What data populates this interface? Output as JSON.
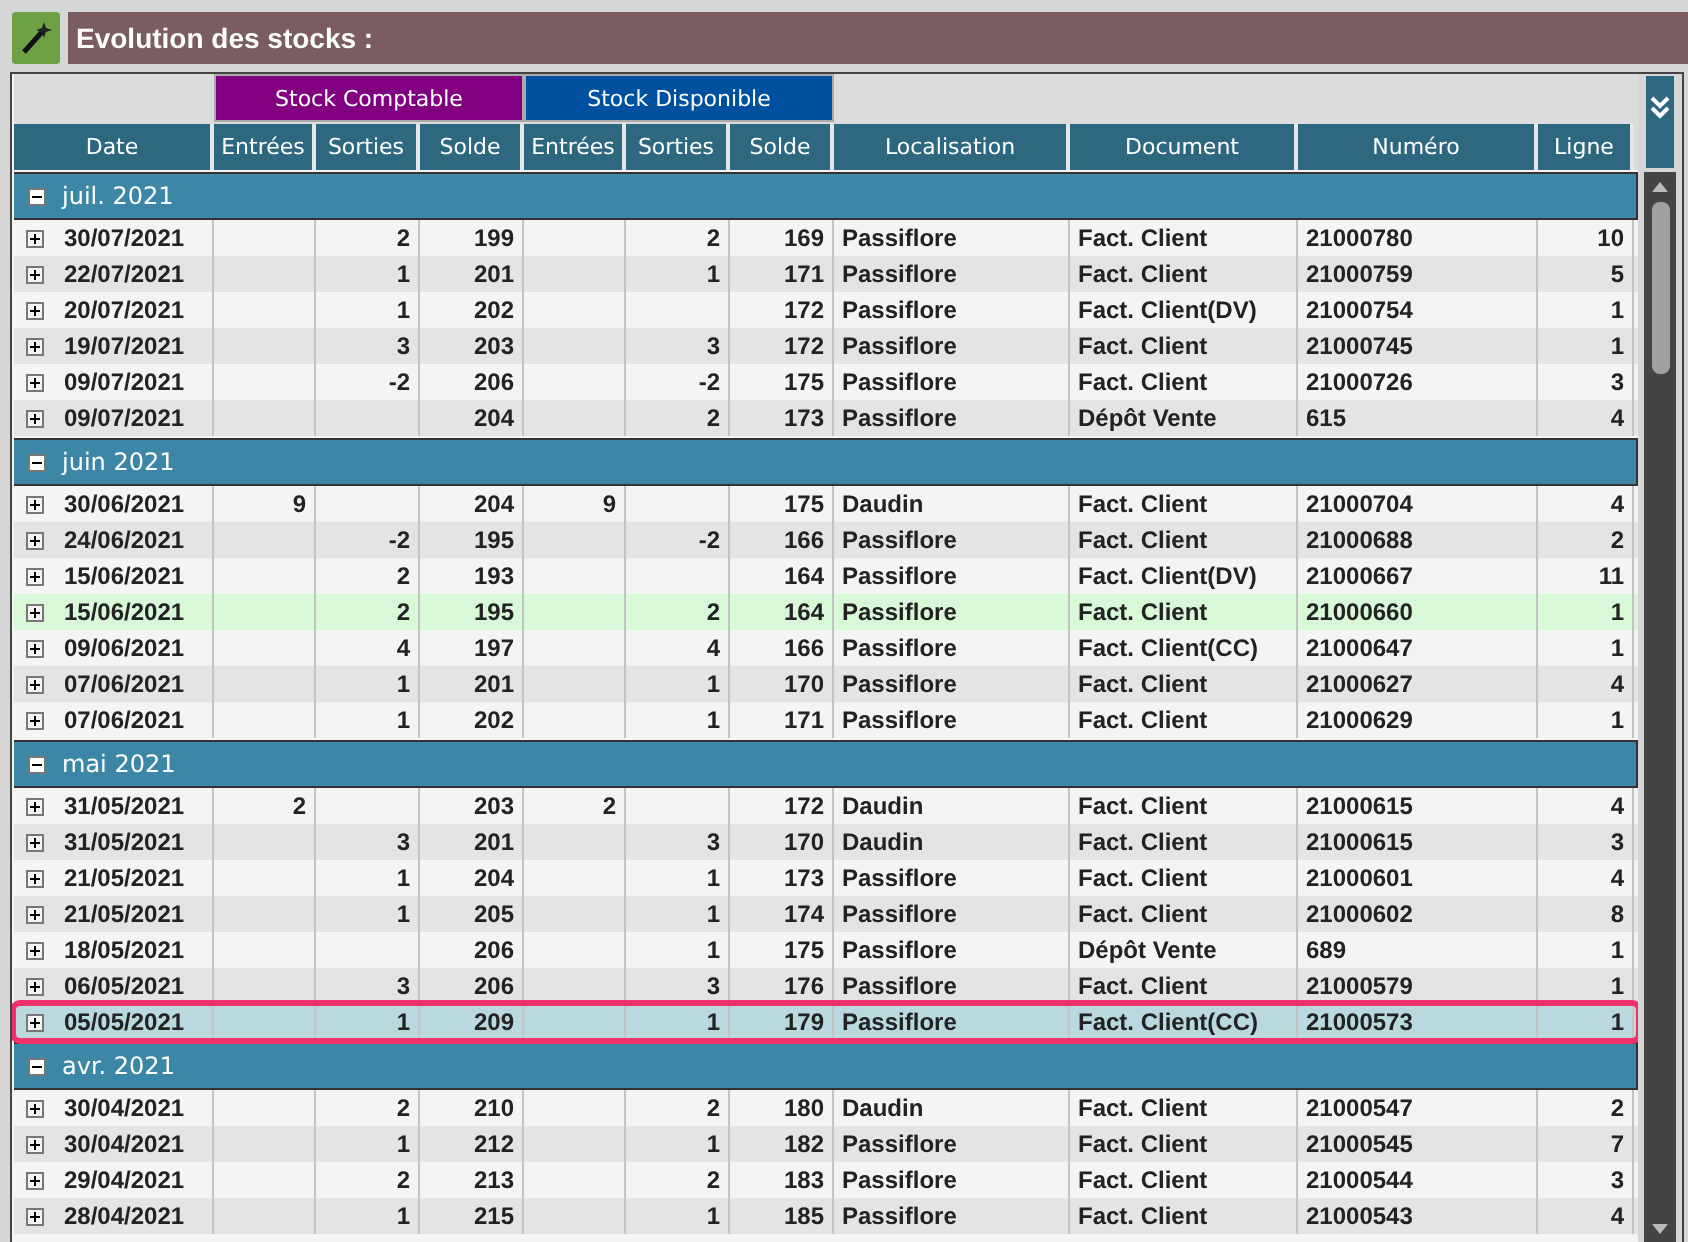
{
  "title": "Evolution des stocks :",
  "column_groups": [
    {
      "label": "Stock Comptable",
      "color": "#800080"
    },
    {
      "label": "Stock Disponible",
      "color": "#0050a0"
    }
  ],
  "columns": [
    "Date",
    "Entrées",
    "Sorties",
    "Solde",
    "Entrées",
    "Sorties",
    "Solde",
    "Localisation",
    "Document",
    "Numéro",
    "Ligne"
  ],
  "months": [
    {
      "label": "juil. 2021",
      "expanded": true,
      "rows": [
        {
          "expanded": false,
          "selected": false,
          "highlighted": false,
          "date": "30/07/2021",
          "out_accounting": "2",
          "balance_accounting": "199",
          "out_available": "2",
          "balance_available": "169",
          "location": "Passiflore",
          "document": "Fact. Client",
          "number": "21000780",
          "line": "10"
        },
        {
          "expanded": false,
          "selected": false,
          "highlighted": false,
          "date": "22/07/2021",
          "out_accounting": "1",
          "balance_accounting": "201",
          "out_available": "1",
          "balance_available": "171",
          "location": "Passiflore",
          "document": "Fact. Client",
          "number": "21000759",
          "line": "5"
        },
        {
          "expanded": false,
          "selected": false,
          "highlighted": false,
          "date": "20/07/2021",
          "out_accounting": "1",
          "balance_accounting": "202",
          "balance_available": "172",
          "location": "Passiflore",
          "document": "Fact. Client(DV)",
          "number": "21000754",
          "line": "1"
        },
        {
          "expanded": false,
          "selected": false,
          "highlighted": false,
          "date": "19/07/2021",
          "out_accounting": "3",
          "balance_accounting": "203",
          "out_available": "3",
          "balance_available": "172",
          "location": "Passiflore",
          "document": "Fact. Client",
          "number": "21000745",
          "line": "1"
        },
        {
          "expanded": false,
          "selected": false,
          "highlighted": false,
          "date": "09/07/2021",
          "out_accounting": "-2",
          "balance_accounting": "206",
          "out_available": "-2",
          "balance_available": "175",
          "location": "Passiflore",
          "document": "Fact. Client",
          "number": "21000726",
          "line": "3"
        },
        {
          "expanded": false,
          "selected": false,
          "highlighted": false,
          "date": "09/07/2021",
          "balance_accounting": "204",
          "out_available": "2",
          "balance_available": "173",
          "location": "Passiflore",
          "document": "Dépôt Vente",
          "number": "615",
          "line": "4"
        }
      ]
    },
    {
      "label": "juin 2021",
      "expanded": true,
      "rows": [
        {
          "expanded": false,
          "selected": false,
          "highlighted": false,
          "date": "30/06/2021",
          "in_accounting": "9",
          "balance_accounting": "204",
          "in_available": "9",
          "balance_available": "175",
          "location": "Daudin",
          "document": "Fact. Client",
          "number": "21000704",
          "line": "4"
        },
        {
          "expanded": false,
          "selected": false,
          "highlighted": false,
          "date": "24/06/2021",
          "out_accounting": "-2",
          "balance_accounting": "195",
          "out_available": "-2",
          "balance_available": "166",
          "location": "Passiflore",
          "document": "Fact. Client",
          "number": "21000688",
          "line": "2"
        },
        {
          "expanded": false,
          "selected": false,
          "highlighted": false,
          "date": "15/06/2021",
          "out_accounting": "2",
          "balance_accounting": "193",
          "balance_available": "164",
          "location": "Passiflore",
          "document": "Fact. Client(DV)",
          "number": "21000667",
          "line": "11"
        },
        {
          "expanded": false,
          "selected": false,
          "highlighted": true,
          "date": "15/06/2021",
          "out_accounting": "2",
          "balance_accounting": "195",
          "out_available": "2",
          "balance_available": "164",
          "location": "Passiflore",
          "document": "Fact. Client",
          "number": "21000660",
          "line": "1"
        },
        {
          "expanded": false,
          "selected": false,
          "highlighted": false,
          "date": "09/06/2021",
          "out_accounting": "4",
          "balance_accounting": "197",
          "out_available": "4",
          "balance_available": "166",
          "location": "Passiflore",
          "document": "Fact. Client(CC)",
          "number": "21000647",
          "line": "1"
        },
        {
          "expanded": false,
          "selected": false,
          "highlighted": false,
          "date": "07/06/2021",
          "out_accounting": "1",
          "balance_accounting": "201",
          "out_available": "1",
          "balance_available": "170",
          "location": "Passiflore",
          "document": "Fact. Client",
          "number": "21000627",
          "line": "4"
        },
        {
          "expanded": false,
          "selected": false,
          "highlighted": false,
          "date": "07/06/2021",
          "out_accounting": "1",
          "balance_accounting": "202",
          "out_available": "1",
          "balance_available": "171",
          "location": "Passiflore",
          "document": "Fact. Client",
          "number": "21000629",
          "line": "1"
        }
      ]
    },
    {
      "label": "mai 2021",
      "expanded": true,
      "rows": [
        {
          "expanded": false,
          "selected": false,
          "highlighted": false,
          "date": "31/05/2021",
          "in_accounting": "2",
          "balance_accounting": "203",
          "in_available": "2",
          "balance_available": "172",
          "location": "Daudin",
          "document": "Fact. Client",
          "number": "21000615",
          "line": "4"
        },
        {
          "expanded": false,
          "selected": false,
          "highlighted": false,
          "date": "31/05/2021",
          "out_accounting": "3",
          "balance_accounting": "201",
          "out_available": "3",
          "balance_available": "170",
          "location": "Daudin",
          "document": "Fact. Client",
          "number": "21000615",
          "line": "3"
        },
        {
          "expanded": false,
          "selected": false,
          "highlighted": false,
          "date": "21/05/2021",
          "out_accounting": "1",
          "balance_accounting": "204",
          "out_available": "1",
          "balance_available": "173",
          "location": "Passiflore",
          "document": "Fact. Client",
          "number": "21000601",
          "line": "4"
        },
        {
          "expanded": false,
          "selected": false,
          "highlighted": false,
          "date": "21/05/2021",
          "out_accounting": "1",
          "balance_accounting": "205",
          "out_available": "1",
          "balance_available": "174",
          "location": "Passiflore",
          "document": "Fact. Client",
          "number": "21000602",
          "line": "8"
        },
        {
          "expanded": false,
          "selected": false,
          "highlighted": false,
          "date": "18/05/2021",
          "balance_accounting": "206",
          "out_available": "1",
          "balance_available": "175",
          "location": "Passiflore",
          "document": "Dépôt Vente",
          "number": "689",
          "line": "1"
        },
        {
          "expanded": false,
          "selected": false,
          "highlighted": false,
          "date": "06/05/2021",
          "out_accounting": "3",
          "balance_accounting": "206",
          "out_available": "3",
          "balance_available": "176",
          "location": "Passiflore",
          "document": "Fact. Client",
          "number": "21000579",
          "line": "1"
        },
        {
          "expanded": false,
          "selected": true,
          "highlighted": false,
          "date": "05/05/2021",
          "out_accounting": "1",
          "balance_accounting": "209",
          "out_available": "1",
          "balance_available": "179",
          "location": "Passiflore",
          "document": "Fact. Client(CC)",
          "number": "21000573",
          "line": "1"
        }
      ]
    },
    {
      "label": "avr. 2021",
      "expanded": true,
      "rows": [
        {
          "expanded": false,
          "selected": false,
          "highlighted": false,
          "date": "30/04/2021",
          "out_accounting": "2",
          "balance_accounting": "210",
          "out_available": "2",
          "balance_available": "180",
          "location": "Daudin",
          "document": "Fact. Client",
          "number": "21000547",
          "line": "2"
        },
        {
          "expanded": false,
          "selected": false,
          "highlighted": false,
          "date": "30/04/2021",
          "out_accounting": "1",
          "balance_accounting": "212",
          "out_available": "1",
          "balance_available": "182",
          "location": "Passiflore",
          "document": "Fact. Client",
          "number": "21000545",
          "line": "7"
        },
        {
          "expanded": false,
          "selected": false,
          "highlighted": false,
          "date": "29/04/2021",
          "out_accounting": "2",
          "balance_accounting": "213",
          "out_available": "2",
          "balance_available": "183",
          "location": "Passiflore",
          "document": "Fact. Client",
          "number": "21000544",
          "line": "3"
        },
        {
          "expanded": false,
          "selected": false,
          "highlighted": false,
          "date": "28/04/2021",
          "out_accounting": "1",
          "balance_accounting": "215",
          "out_available": "1",
          "balance_available": "185",
          "location": "Passiflore",
          "document": "Fact. Client",
          "number": "21000543",
          "line": "4"
        }
      ]
    }
  ]
}
